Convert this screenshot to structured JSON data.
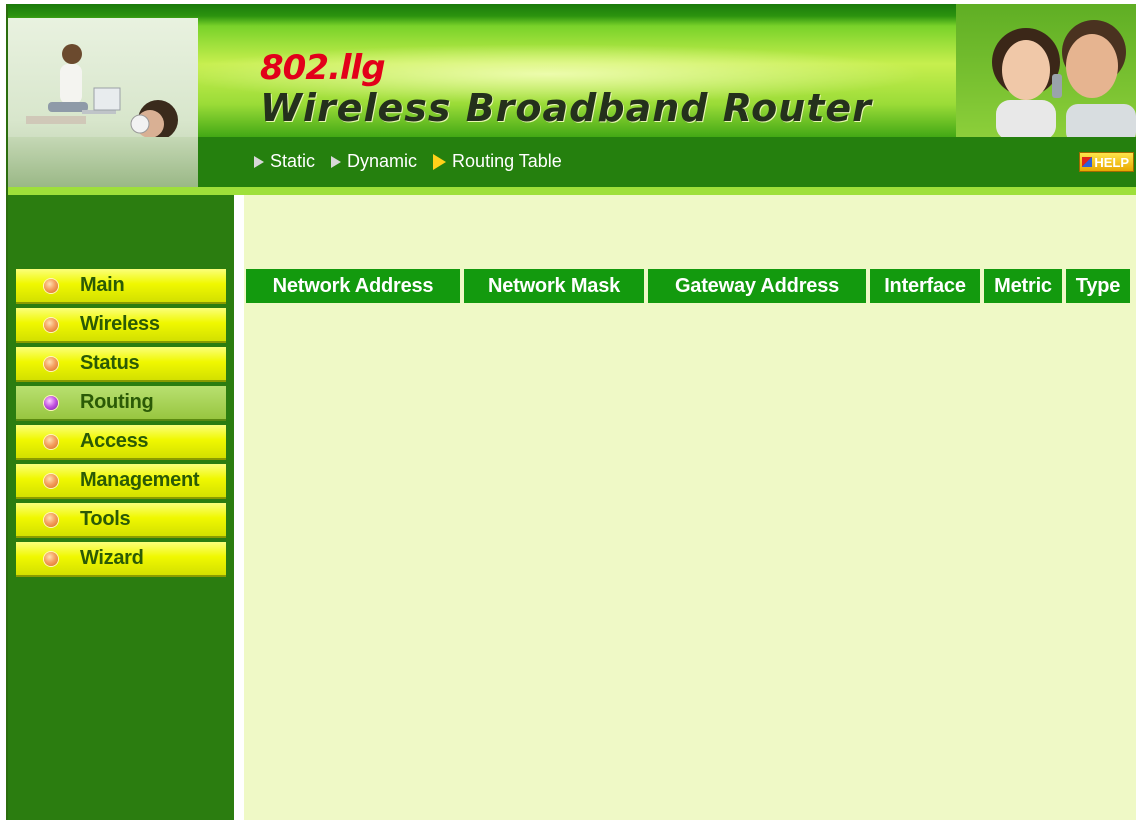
{
  "header": {
    "model": "802.llg",
    "title": "Wireless Broadband Router"
  },
  "subnav": {
    "items": [
      {
        "label": "Static",
        "active": false
      },
      {
        "label": "Dynamic",
        "active": false
      },
      {
        "label": "Routing Table",
        "active": true
      }
    ],
    "help_label": "HELP"
  },
  "sidebar": {
    "items": [
      {
        "label": "Main",
        "active": false
      },
      {
        "label": "Wireless",
        "active": false
      },
      {
        "label": "Status",
        "active": false
      },
      {
        "label": "Routing",
        "active": true
      },
      {
        "label": "Access",
        "active": false
      },
      {
        "label": "Management",
        "active": false
      },
      {
        "label": "Tools",
        "active": false
      },
      {
        "label": "Wizard",
        "active": false
      }
    ]
  },
  "routing_table": {
    "columns": [
      "Network Address",
      "Network Mask",
      "Gateway Address",
      "Interface",
      "Metric",
      "Type"
    ],
    "rows": []
  },
  "colors": {
    "header_green": "#25800e",
    "sidebar_green": "#2b7d10",
    "table_header_green": "#139a0e",
    "content_bg": "#eff9c6",
    "menu_yellow": "#f0f800",
    "brand_red": "#e2001a"
  }
}
